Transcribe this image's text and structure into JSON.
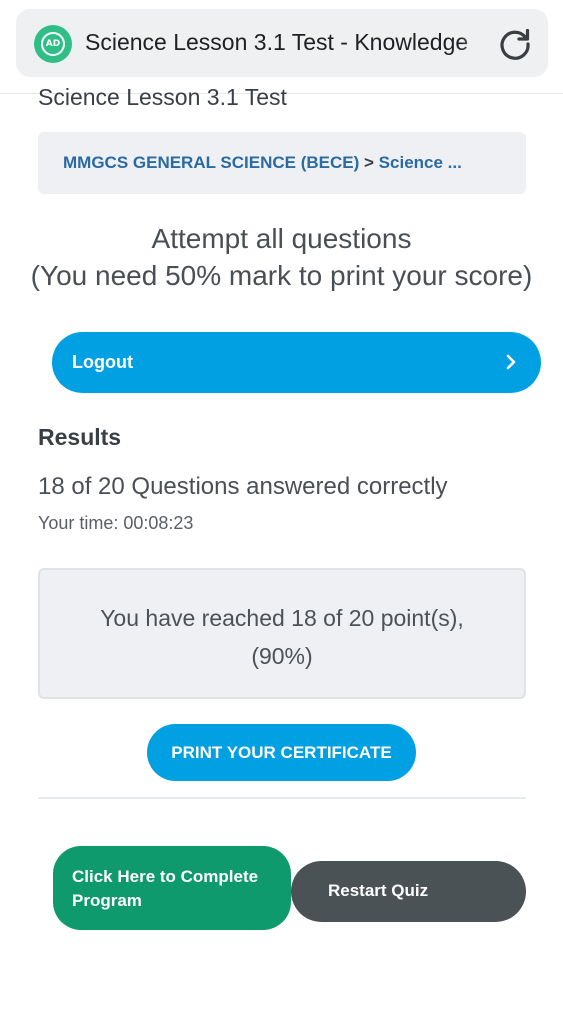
{
  "browser": {
    "site_icon_text": "AD",
    "page_title": "Science Lesson 3.1 Test - Knowledge",
    "reload_icon": "reload-icon"
  },
  "lesson": {
    "title": "Science Lesson 3.1 Test",
    "breadcrumb": {
      "course": "MMGCS GENERAL SCIENCE (BECE)",
      "separator": ">",
      "current": "Science ..."
    }
  },
  "instructions": {
    "line1": "Attempt all questions",
    "line2": "(You need 50% mark to print your score)"
  },
  "logout": {
    "label": "Logout",
    "icon": "chevron-right-icon"
  },
  "results": {
    "heading": "Results",
    "answered": "18 of 20 Questions answered correctly",
    "time": "Your time: 00:08:23",
    "score_line1": "You have reached 18 of 20 point(s),",
    "score_line2": "(90%)"
  },
  "actions": {
    "print_label": "PRINT YOUR CERTIFICATE",
    "complete_label": "Click Here to Complete Program",
    "restart_label": "Restart Quiz"
  },
  "colors": {
    "primary_blue": "#00a0e3",
    "green": "#0f9a6e",
    "dark_gray": "#4b5255",
    "link_blue": "#2b6aa3"
  }
}
